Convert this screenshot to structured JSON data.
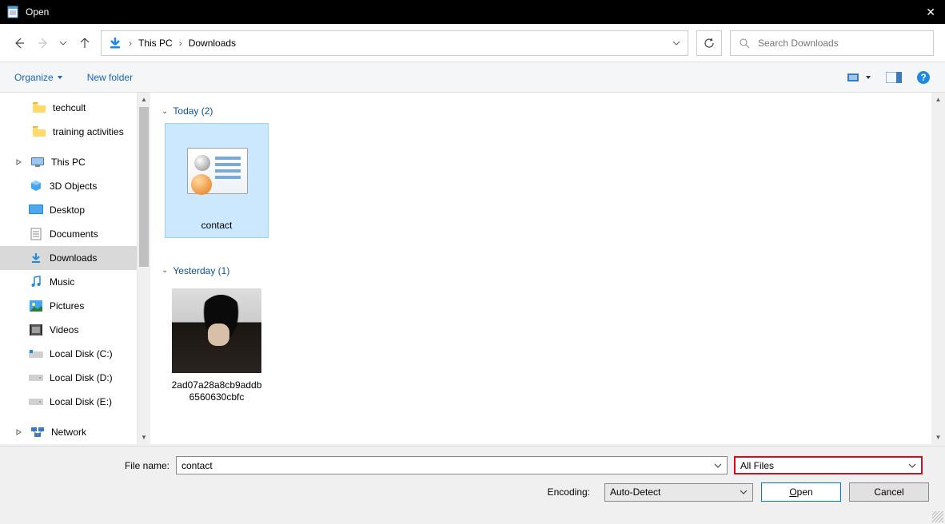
{
  "window": {
    "title": "Open"
  },
  "breadcrumb": {
    "root": "This PC",
    "current": "Downloads"
  },
  "search": {
    "placeholder": "Search Downloads"
  },
  "toolbar": {
    "organize": "Organize",
    "new_folder": "New folder"
  },
  "sidebar": {
    "quick": [
      {
        "label": "techcult"
      },
      {
        "label": "training activities"
      }
    ],
    "thispc_label": "This PC",
    "thispc": [
      {
        "label": "3D Objects"
      },
      {
        "label": "Desktop"
      },
      {
        "label": "Documents"
      },
      {
        "label": "Downloads",
        "selected": true
      },
      {
        "label": "Music"
      },
      {
        "label": "Pictures"
      },
      {
        "label": "Videos"
      },
      {
        "label": "Local Disk (C:)"
      },
      {
        "label": "Local Disk (D:)"
      },
      {
        "label": "Local Disk (E:)"
      }
    ],
    "network_label": "Network"
  },
  "groups": {
    "today": {
      "header": "Today (2)",
      "items": [
        {
          "name": "contact",
          "selected": true
        }
      ]
    },
    "yesterday": {
      "header": "Yesterday (1)",
      "items": [
        {
          "name": "2ad07a28a8cb9addb6560630cbfc"
        }
      ]
    }
  },
  "footer": {
    "filename_label": "File name:",
    "filename_value": "contact",
    "filetype_value": "All Files",
    "encoding_label": "Encoding:",
    "encoding_value": "Auto-Detect",
    "open_prefix": "O",
    "open_rest": "pen",
    "cancel": "Cancel"
  }
}
